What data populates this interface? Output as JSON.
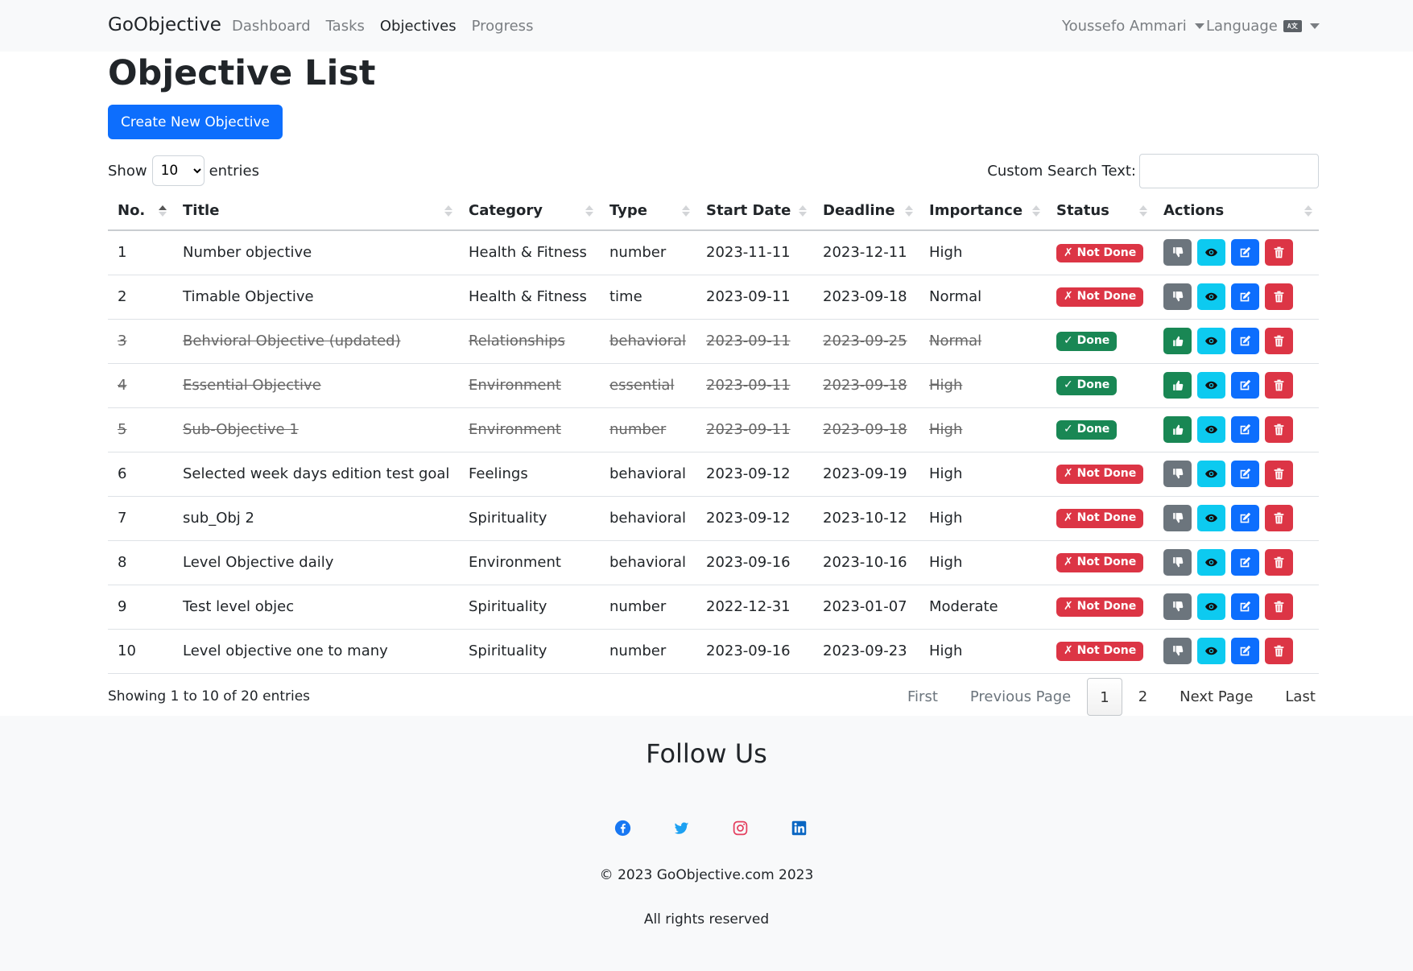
{
  "navbar": {
    "brand": "GoObjective",
    "links": [
      {
        "label": "Dashboard",
        "active": false
      },
      {
        "label": "Tasks",
        "active": false
      },
      {
        "label": "Objectives",
        "active": true
      },
      {
        "label": "Progress",
        "active": false
      }
    ],
    "user_menu": "Youssefo Ammari",
    "language_menu": "Language",
    "language_icon": "language-icon"
  },
  "page": {
    "title": "Objective List",
    "create_button": "Create New Objective"
  },
  "table_controls": {
    "show_label": "Show",
    "entries_label": "entries",
    "page_length": "10",
    "page_length_options": [
      "10"
    ],
    "search_label": "Custom Search Text:",
    "search_value": ""
  },
  "table": {
    "columns": [
      "No.",
      "Title",
      "Category",
      "Type",
      "Start Date",
      "Deadline",
      "Importance",
      "Status",
      "Actions"
    ],
    "sorted_column": "No.",
    "rows": [
      {
        "no": "1",
        "title": "Number objective",
        "category": "Health & Fitness",
        "type": "number",
        "start": "2023-11-11",
        "deadline": "2023-12-11",
        "importance": "High",
        "status": "✗ Not Done",
        "done": false
      },
      {
        "no": "2",
        "title": "Timable Objective",
        "category": "Health & Fitness",
        "type": "time",
        "start": "2023-09-11",
        "deadline": "2023-09-18",
        "importance": "Normal",
        "status": "✗ Not Done",
        "done": false
      },
      {
        "no": "3",
        "title": "Behvioral Objective (updated)",
        "category": "Relationships",
        "type": "behavioral",
        "start": "2023-09-11",
        "deadline": "2023-09-25",
        "importance": "Normal",
        "status": "✓ Done",
        "done": true
      },
      {
        "no": "4",
        "title": "Essential Objective",
        "category": "Environment",
        "type": "essential",
        "start": "2023-09-11",
        "deadline": "2023-09-18",
        "importance": "High",
        "status": "✓ Done",
        "done": true
      },
      {
        "no": "5",
        "title": "Sub-Objective 1",
        "category": "Environment",
        "type": "number",
        "start": "2023-09-11",
        "deadline": "2023-09-18",
        "importance": "High",
        "status": "✓ Done",
        "done": true
      },
      {
        "no": "6",
        "title": "Selected week days edition test goal",
        "category": "Feelings",
        "type": "behavioral",
        "start": "2023-09-12",
        "deadline": "2023-09-19",
        "importance": "High",
        "status": "✗ Not Done",
        "done": false
      },
      {
        "no": "7",
        "title": "sub_Obj 2",
        "category": "Spirituality",
        "type": "behavioral",
        "start": "2023-09-12",
        "deadline": "2023-10-12",
        "importance": "High",
        "status": "✗ Not Done",
        "done": false
      },
      {
        "no": "8",
        "title": "Level Objective daily",
        "category": "Environment",
        "type": "behavioral",
        "start": "2023-09-16",
        "deadline": "2023-10-16",
        "importance": "High",
        "status": "✗ Not Done",
        "done": false
      },
      {
        "no": "9",
        "title": "Test level objec",
        "category": "Spirituality",
        "type": "number",
        "start": "2022-12-31",
        "deadline": "2023-01-07",
        "importance": "Moderate",
        "status": "✗ Not Done",
        "done": false
      },
      {
        "no": "10",
        "title": "Level objective one to many",
        "category": "Spirituality",
        "type": "number",
        "start": "2023-09-16",
        "deadline": "2023-09-23",
        "importance": "High",
        "status": "✗ Not Done",
        "done": false
      }
    ],
    "action_icons": [
      "thumbs-up-icon",
      "eye-icon",
      "edit-icon",
      "trash-icon"
    ]
  },
  "pagination": {
    "info": "Showing 1 to 10 of 20 entries",
    "first": "First",
    "previous": "Previous Page",
    "pages": [
      "1",
      "2"
    ],
    "current_page": "1",
    "next": "Next Page",
    "last": "Last"
  },
  "footer": {
    "follow_title": "Follow Us",
    "socials": [
      {
        "icon": "facebook-icon",
        "color": "#1877f2"
      },
      {
        "icon": "twitter-icon",
        "color": "#1da1f2"
      },
      {
        "icon": "instagram-icon",
        "color": "#e4405f"
      },
      {
        "icon": "linkedin-icon",
        "color": "#0a66c2"
      }
    ],
    "copyright": "© 2023 GoObjective.com 2023",
    "rights": "All rights reserved"
  },
  "colors": {
    "primary": "#0d6efd",
    "danger": "#dc3545",
    "success": "#198754",
    "info": "#0dcaf0",
    "secondary": "#6c757d"
  }
}
